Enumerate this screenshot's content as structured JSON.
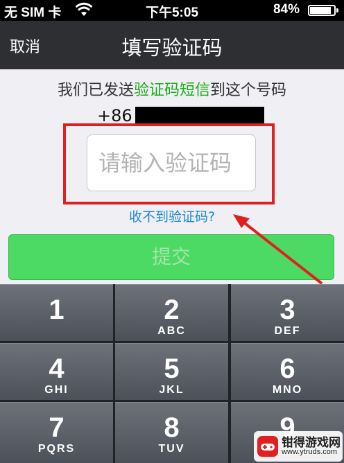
{
  "status_bar": {
    "carrier": "无 SIM 卡",
    "time": "下午5:05",
    "battery_percent": "84%",
    "battery_level": 0.84,
    "wifi_icon": "wifi-icon",
    "battery_icon": "battery-icon"
  },
  "nav": {
    "cancel_label": "取消",
    "title": "填写验证码"
  },
  "instruction": {
    "prefix": "我们已发送",
    "highlight": "验证码短信",
    "suffix": "到这个号码"
  },
  "phone": {
    "country_code": "+86"
  },
  "code_input": {
    "placeholder": "请输入验证码",
    "value": ""
  },
  "no_code_link": "收不到验证码?",
  "submit_label": "提交",
  "keypad": [
    {
      "digit": "1",
      "letters": ""
    },
    {
      "digit": "2",
      "letters": "ABC"
    },
    {
      "digit": "3",
      "letters": "DEF"
    },
    {
      "digit": "4",
      "letters": "GHI"
    },
    {
      "digit": "5",
      "letters": "JKL"
    },
    {
      "digit": "6",
      "letters": "MNO"
    },
    {
      "digit": "7",
      "letters": "PQRS"
    },
    {
      "digit": "8",
      "letters": "TUV"
    },
    {
      "digit": "9",
      "letters": ""
    }
  ],
  "watermark": {
    "name": "钳得游戏网",
    "url": "www.ytruds.com"
  },
  "colors": {
    "accent_green": "#1aad19",
    "button_green": "#4cd964",
    "link_blue": "#1f88d6",
    "annotation_red": "#e02020",
    "nav_bg": "#2e2f32"
  }
}
